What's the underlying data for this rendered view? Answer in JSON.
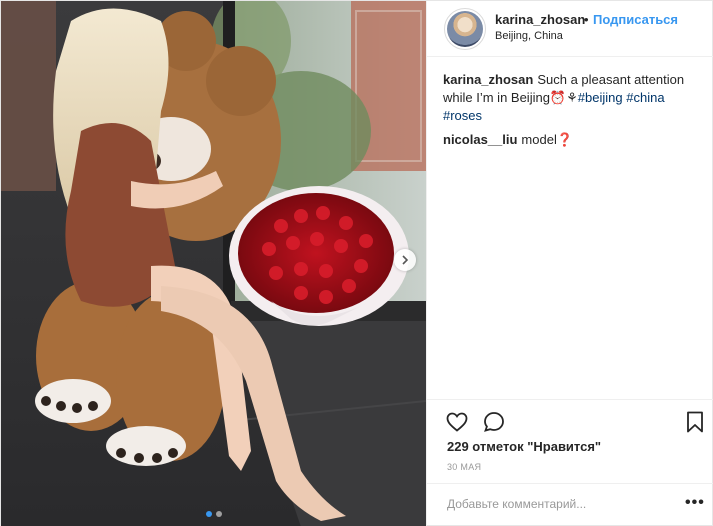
{
  "post": {
    "username": "karina_zhosan",
    "separator": "•",
    "follow_label": "Подписаться",
    "location": "Beijing, China",
    "caption": {
      "username": "karina_zhosan",
      "text": "Such a pleasant attention while I’m in Beijing⏰⚘",
      "hashtags": [
        "#beijing",
        "#china",
        "#roses"
      ]
    },
    "comments": [
      {
        "username": "nicolas__liu",
        "text": "model❓"
      }
    ],
    "likes_label": "229 отметок \"Нравится\"",
    "date": "30 мая",
    "add_comment_placeholder": "Добавьте комментарий...",
    "more_label": "•••"
  },
  "icons": {
    "like": "heart-icon",
    "comment": "comment-icon",
    "save": "bookmark-icon",
    "carousel_next": "chevron-right-icon"
  },
  "carousel": {
    "active_index": 0,
    "count": 2
  },
  "colors": {
    "link": "#3897f0",
    "hashtag": "#003569",
    "muted": "#999999",
    "text": "#262626"
  }
}
